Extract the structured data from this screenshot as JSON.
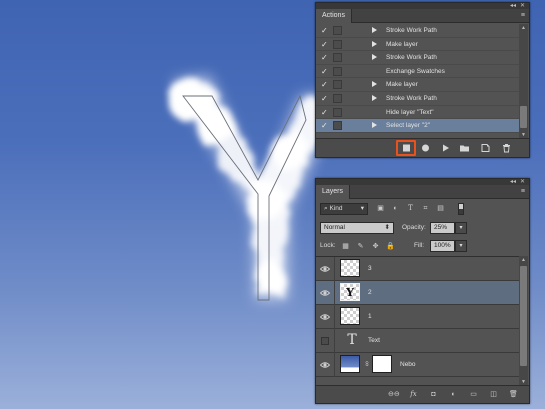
{
  "actions_panel": {
    "title": "Actions",
    "collapse_glyph": "◂◂",
    "close_glyph": "✕",
    "menu_glyph": "≡",
    "items": [
      {
        "label": "Stroke Work Path",
        "checked": true,
        "expandable": true,
        "selected": false
      },
      {
        "label": "Make layer",
        "checked": true,
        "expandable": true,
        "selected": false
      },
      {
        "label": "Stroke Work Path",
        "checked": true,
        "expandable": true,
        "selected": false
      },
      {
        "label": "Exchange Swatches",
        "checked": true,
        "expandable": false,
        "selected": false
      },
      {
        "label": "Make layer",
        "checked": true,
        "expandable": true,
        "selected": false
      },
      {
        "label": "Stroke Work Path",
        "checked": true,
        "expandable": true,
        "selected": false
      },
      {
        "label": "Hide layer \"Text\"",
        "checked": true,
        "expandable": false,
        "selected": false
      },
      {
        "label": "Select layer \"2\"",
        "checked": true,
        "expandable": true,
        "selected": true
      }
    ],
    "footer_buttons": [
      "stop-recording",
      "record",
      "play",
      "new-set",
      "new-action",
      "delete"
    ],
    "highlight_color": "#e8521f"
  },
  "layers_panel": {
    "title": "Layers",
    "collapse_glyph": "◂◂",
    "close_glyph": "✕",
    "menu_glyph": "≡",
    "filter": {
      "kind_label": "Kind",
      "kind_glyph": "⌕"
    },
    "blend_mode": "Normal",
    "opacity_label": "Opacity:",
    "opacity_value": "25%",
    "lock_label": "Lock:",
    "fill_label": "Fill:",
    "fill_value": "100%",
    "layers": [
      {
        "name": "3",
        "visible": true,
        "kind": "raster",
        "selected": false
      },
      {
        "name": "2",
        "visible": true,
        "kind": "raster-y",
        "selected": true
      },
      {
        "name": "1",
        "visible": true,
        "kind": "raster",
        "selected": false
      },
      {
        "name": "Text",
        "visible": false,
        "kind": "text",
        "selected": false
      },
      {
        "name": "Nebo",
        "visible": true,
        "kind": "masked",
        "selected": false
      }
    ],
    "footer_glyphs": [
      "⊖⊖",
      "fx",
      "◘",
      "◐",
      "▭",
      "◫",
      "🗑"
    ]
  },
  "canvas": {
    "letter": "Y",
    "sky_top": "#3f64b2",
    "sky_bottom": "#9bb0da"
  },
  "colors": {
    "panel_bg": "#535353",
    "selection": "#6a7f9c"
  }
}
